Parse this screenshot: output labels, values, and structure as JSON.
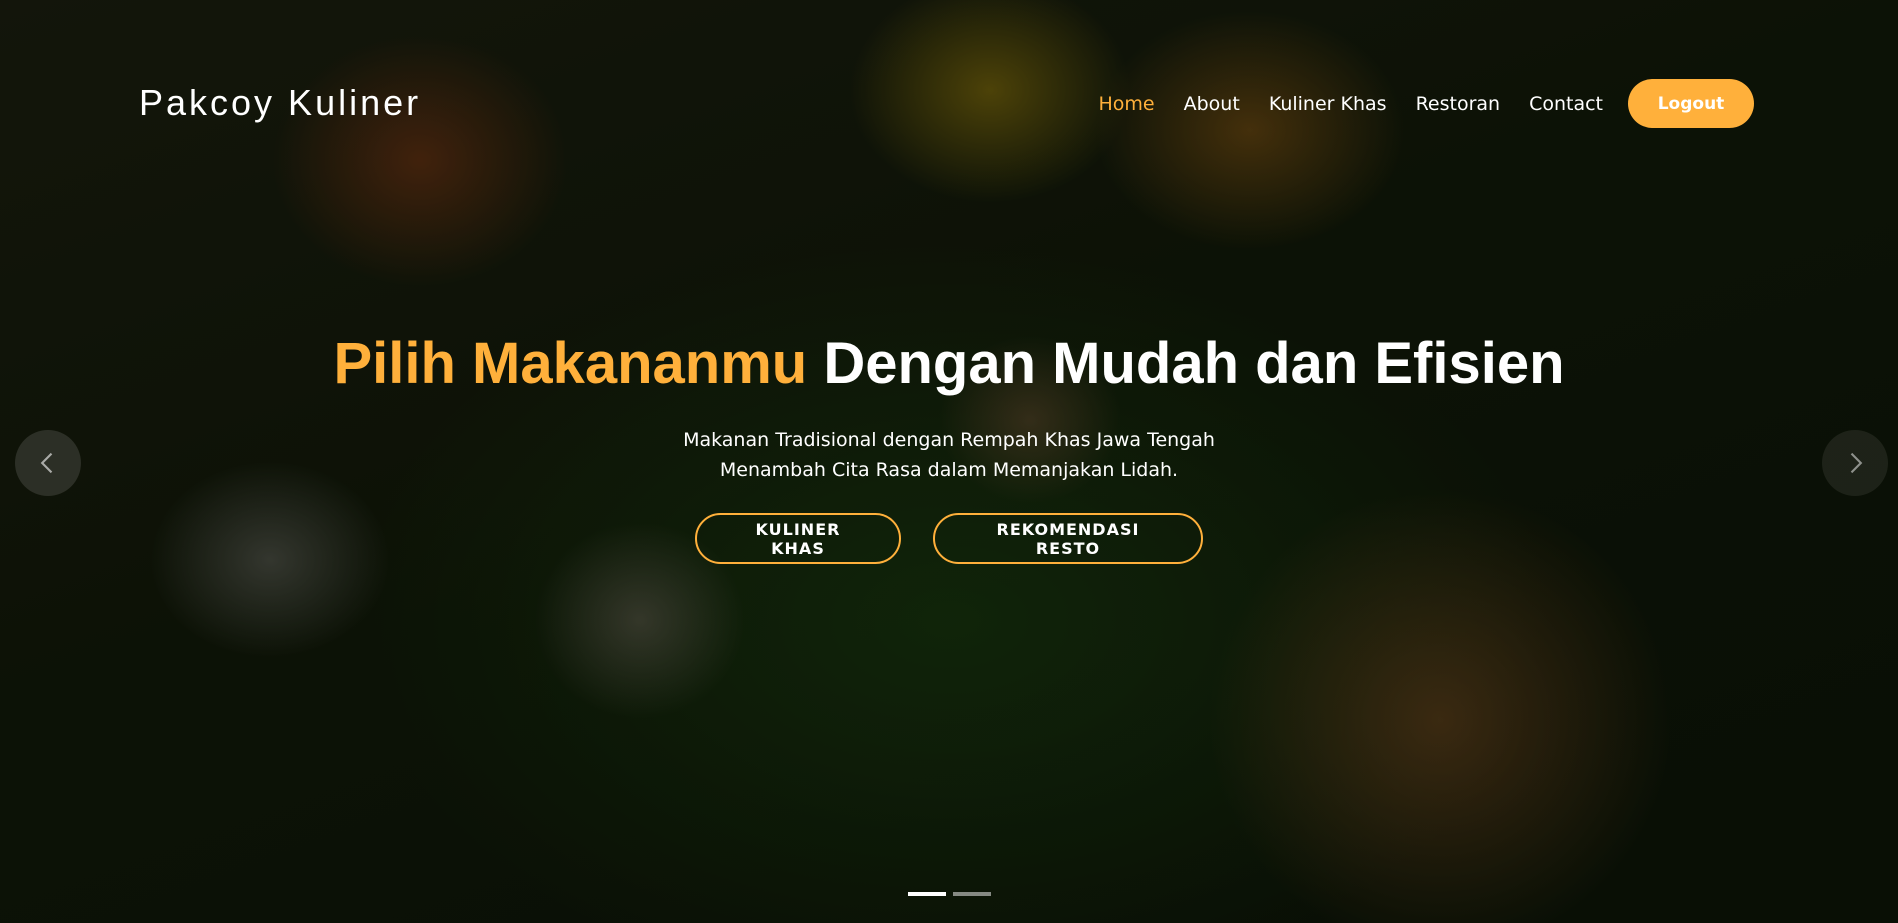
{
  "brand": "Pakcoy Kuliner",
  "nav": {
    "links": [
      {
        "label": "Home",
        "active": true
      },
      {
        "label": "About"
      },
      {
        "label": "Kuliner Khas"
      },
      {
        "label": "Restoran"
      },
      {
        "label": "Contact"
      }
    ],
    "logout_label": "Logout"
  },
  "hero": {
    "title_accent": "Pilih Makananmu",
    "title_rest": "Dengan Mudah dan Efisien",
    "subtitle_line1": "Makanan Tradisional dengan Rempah Khas Jawa Tengah",
    "subtitle_line2": "Menambah Cita Rasa dalam Memanjakan Lidah.",
    "cta_primary": "KULINER KHAS",
    "cta_secondary": "REKOMENDASI RESTO"
  },
  "carousel": {
    "prev_icon": "chevron-left-icon",
    "next_icon": "chevron-right-icon",
    "slides": 2,
    "active_slide": 1
  },
  "colors": {
    "accent": "#ffb03b",
    "text": "#ffffff"
  }
}
